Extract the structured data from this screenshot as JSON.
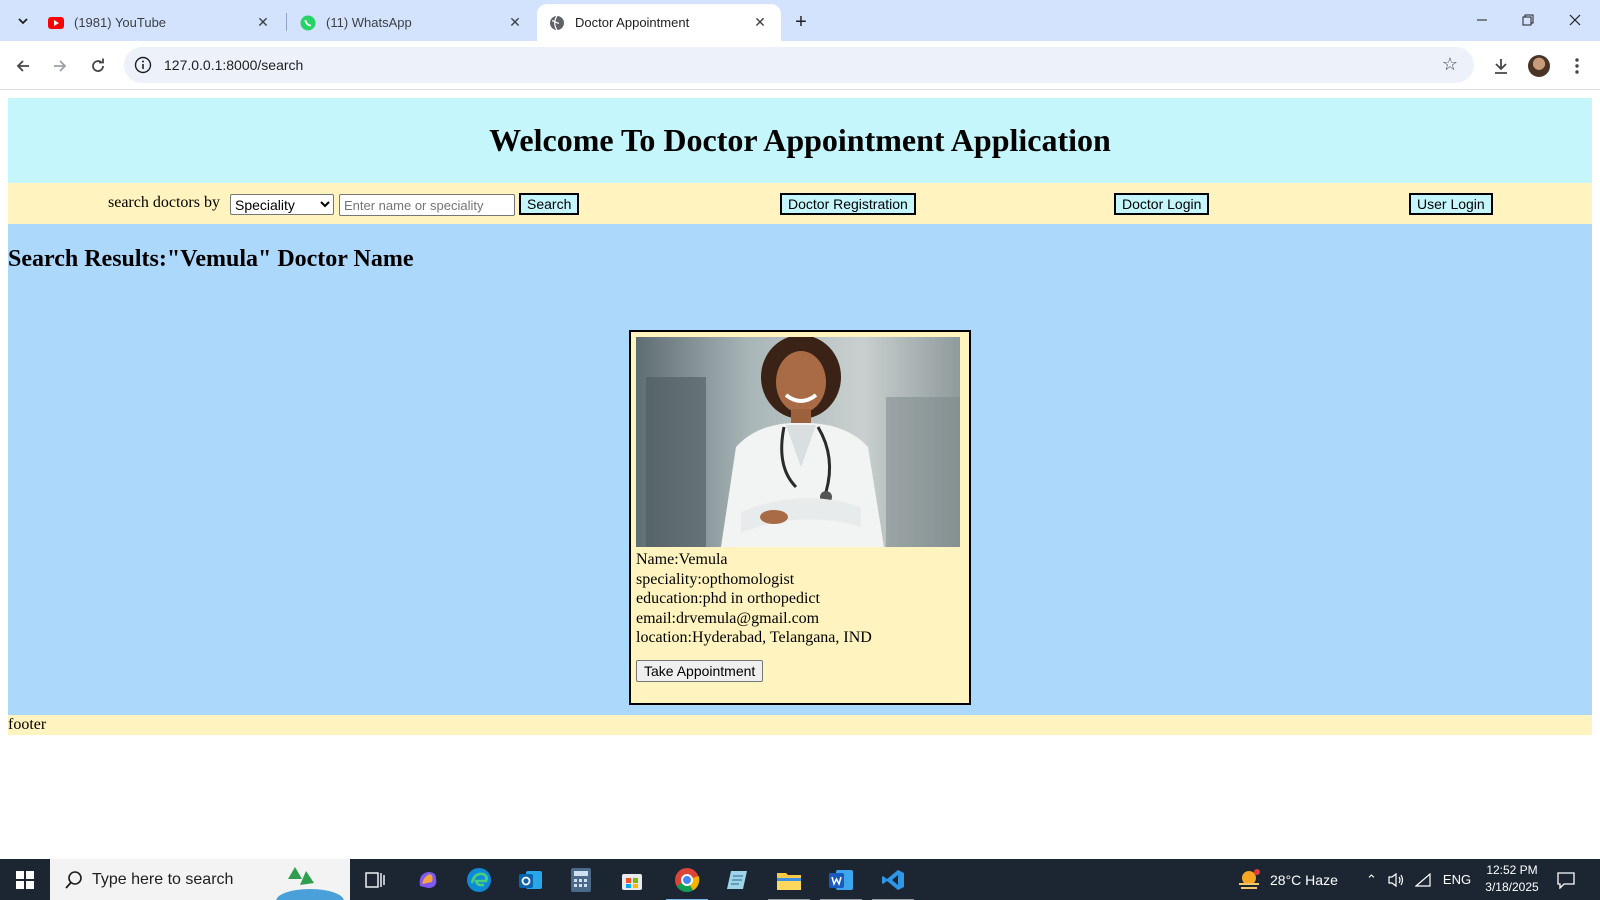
{
  "browser": {
    "tabs": [
      {
        "title": "(1981) YouTube",
        "icon": "youtube-icon",
        "active": false
      },
      {
        "title": "(11) WhatsApp",
        "icon": "whatsapp-icon",
        "active": false
      },
      {
        "title": "Doctor Appointment",
        "icon": "globe-icon",
        "active": true
      }
    ],
    "url": "127.0.0.1:8000/search"
  },
  "page": {
    "header_title": "Welcome To Doctor Appointment Application",
    "nav": {
      "search_label": "search doctors by",
      "select_value": "Speciality",
      "search_placeholder": "Enter name or speciality",
      "search_button": "Search",
      "doctor_registration": "Doctor Registration",
      "doctor_login": "Doctor Login",
      "user_login": "User Login"
    },
    "results_heading": "Search Results:\"Vemula\" Doctor Name",
    "doctor": {
      "name_line": "Name:Vemula",
      "speciality_line": "speciality:opthomologist",
      "education_line": "education:phd in orthopedict",
      "email_line": "email:drvemula@gmail.com",
      "location_line": "location:Hyderabad, Telangana, IND",
      "button": "Take Appointment"
    },
    "footer": "footer"
  },
  "taskbar": {
    "search_placeholder": "Type here to search",
    "weather": "28°C  Haze",
    "language": "ENG",
    "time": "12:52 PM",
    "date": "3/18/2025"
  },
  "colors": {
    "header_bg": "#c4f6fc",
    "nav_bg": "#fff4bf",
    "results_bg": "#acd8fc",
    "card_bg": "#fff4bf",
    "tabstrip_bg": "#d3e3fd",
    "taskbar_bg": "#1c2633"
  }
}
